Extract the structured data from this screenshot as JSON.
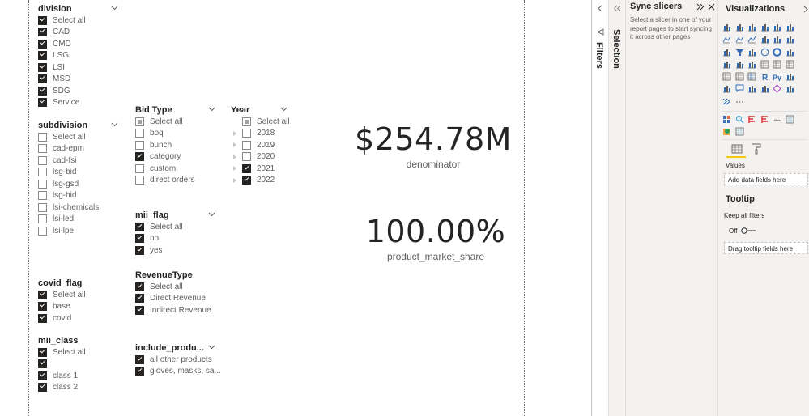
{
  "canvas": {
    "slicers": {
      "division": {
        "title": "division",
        "items": [
          {
            "label": "Select all",
            "state": "on"
          },
          {
            "label": "CAD",
            "state": "on"
          },
          {
            "label": "CMD",
            "state": "on"
          },
          {
            "label": "LSG",
            "state": "on"
          },
          {
            "label": "LSI",
            "state": "on"
          },
          {
            "label": "MSD",
            "state": "on"
          },
          {
            "label": "SDG",
            "state": "on"
          },
          {
            "label": "Service",
            "state": "on"
          }
        ]
      },
      "subdivision": {
        "title": "subdivision",
        "items": [
          {
            "label": "Select all",
            "state": "off"
          },
          {
            "label": "cad-epm",
            "state": "off"
          },
          {
            "label": "cad-fsi",
            "state": "off"
          },
          {
            "label": "lsg-bid",
            "state": "off"
          },
          {
            "label": "lsg-gsd",
            "state": "off"
          },
          {
            "label": "lsg-hid",
            "state": "off"
          },
          {
            "label": "lsi-chemicals",
            "state": "off"
          },
          {
            "label": "lsi-led",
            "state": "off"
          },
          {
            "label": "lsi-lpe",
            "state": "off"
          }
        ]
      },
      "covid_flag": {
        "title": "covid_flag",
        "items": [
          {
            "label": "Select all",
            "state": "on"
          },
          {
            "label": "base",
            "state": "on"
          },
          {
            "label": "covid",
            "state": "on"
          }
        ]
      },
      "mii_class": {
        "title": "mii_class",
        "items": [
          {
            "label": "Select all",
            "state": "on"
          },
          {
            "label": "",
            "state": "on"
          },
          {
            "label": "class 1",
            "state": "on"
          },
          {
            "label": "class 2",
            "state": "on"
          }
        ]
      },
      "bid_type": {
        "title": "Bid Type",
        "items": [
          {
            "label": "Select all",
            "state": "partial"
          },
          {
            "label": "boq",
            "state": "off"
          },
          {
            "label": "bunch",
            "state": "off"
          },
          {
            "label": "category",
            "state": "on"
          },
          {
            "label": "custom",
            "state": "off"
          },
          {
            "label": "direct orders",
            "state": "off"
          }
        ]
      },
      "year": {
        "title": "Year",
        "items": [
          {
            "label": "Select all",
            "state": "partial",
            "expandable": false
          },
          {
            "label": "2018",
            "state": "off",
            "expandable": true
          },
          {
            "label": "2019",
            "state": "off",
            "expandable": true
          },
          {
            "label": "2020",
            "state": "off",
            "expandable": true
          },
          {
            "label": "2021",
            "state": "on",
            "expandable": true
          },
          {
            "label": "2022",
            "state": "on",
            "expandable": true
          }
        ]
      },
      "mii_flag": {
        "title": "mii_flag",
        "items": [
          {
            "label": "Select all",
            "state": "on"
          },
          {
            "label": "no",
            "state": "on"
          },
          {
            "label": "yes",
            "state": "on"
          }
        ]
      },
      "revenue_type": {
        "title": "RevenueType",
        "items": [
          {
            "label": "Select all",
            "state": "on"
          },
          {
            "label": "Direct Revenue",
            "state": "on"
          },
          {
            "label": "Indirect Revenue",
            "state": "on"
          }
        ]
      },
      "include_products": {
        "title": "include_produ...",
        "items": [
          {
            "label": "all other products",
            "state": "on"
          },
          {
            "label": "gloves, masks, sa...",
            "state": "on"
          }
        ]
      }
    },
    "cards": {
      "denominator": {
        "value": "$254.78M",
        "label": "denominator"
      },
      "market_share": {
        "value": "100.00%",
        "label": "product_market_share"
      }
    }
  },
  "panes": {
    "filters": {
      "label": "Filters"
    },
    "selection": {
      "label": "Selection"
    },
    "sync_slicers": {
      "title": "Sync slicers",
      "description": "Select a slicer in one of your report pages to start syncing it across other pages"
    },
    "visualizations": {
      "title": "Visualizations",
      "more_label": "...",
      "values_label": "Values",
      "values_well": "Add data fields here",
      "tooltip_title": "Tooltip",
      "keep_filters_label": "Keep all filters",
      "toggle_state": "Off",
      "tooltip_well": "Drag tooltip fields here"
    }
  }
}
